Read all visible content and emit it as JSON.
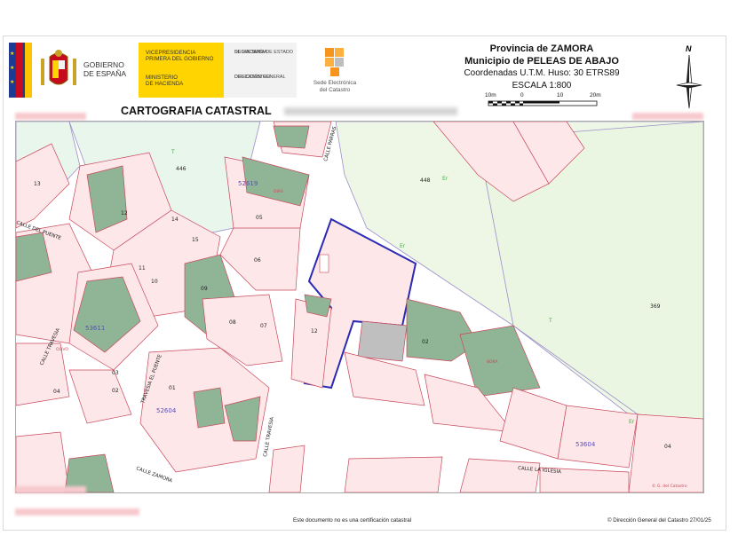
{
  "header": {
    "gov_line1": "GOBIERNO",
    "gov_line2": "DE ESPAÑA",
    "vp_line1": "VICEPRESIDENCIA",
    "vp_line2": "PRIMERA DEL GOBIERNO",
    "min_line1": "MINISTERIO",
    "min_line2": "DE HACIENDA",
    "sec_line1": "SECRETARÍA DE ESTADO",
    "sec_line2": "DE HACIENDA",
    "dir_line1": "DIRECCIÓN GENERAL",
    "dir_line2": "DEL CATASTRO",
    "sede_line1": "Sede Electrónica",
    "sede_line2": "del Catastro"
  },
  "title": {
    "province": "Provincia de ZAMORA",
    "municipality": "Municipio de PELEAS DE ABAJO",
    "coordinates": "Coordenadas U.T.M. Huso: 30 ETRS89",
    "scale": "ESCALA 1:800",
    "scale_ticks": [
      "10m",
      "0",
      "10",
      "20m"
    ]
  },
  "north_label": "N",
  "carto_title": "CARTOGRAFIA CATASTRAL",
  "footer": {
    "disclaimer": "Este documento no es una certificación catastral",
    "copyright": "© Dirección General del Catastro 27/01/25"
  },
  "map": {
    "streets": [
      "CALLE DEL PUENTE",
      "CALLE PARRAS",
      "TRAVESIA EL PUENTE",
      "CALLE TRAVESIA",
      "CALLE ZAMORA",
      "CALLE LA IGLESIA",
      "CALLE TRAVESIA"
    ],
    "blocks": [
      "52619",
      "53611",
      "52604",
      "53604"
    ],
    "parcels": [
      "13",
      "12",
      "14",
      "15",
      "11",
      "10",
      "09",
      "08",
      "07",
      "06",
      "05",
      "04",
      "03",
      "02",
      "01",
      "446",
      "448",
      "369",
      "12",
      "02",
      "04"
    ],
    "labels": [
      "T",
      "Er",
      "Er",
      "T",
      "Er",
      "BOKA",
      "DIAS",
      "OLIVO"
    ],
    "copyright_small": "© G. del Catastro"
  }
}
